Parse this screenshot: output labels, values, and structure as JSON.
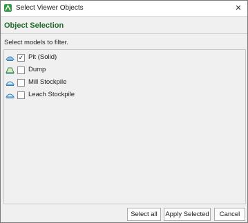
{
  "window": {
    "title": "Select Viewer Objects"
  },
  "section": {
    "heading": "Object Selection",
    "instruction": "Select models to filter."
  },
  "models": [
    {
      "label": "Pit (Solid)",
      "checked": true,
      "icon": "pit-model-icon"
    },
    {
      "label": "Dump",
      "checked": false,
      "icon": "dump-model-icon"
    },
    {
      "label": "Mill Stockpile",
      "checked": false,
      "icon": "stockpile-model-icon"
    },
    {
      "label": "Leach Stockpile",
      "checked": false,
      "icon": "stockpile-model-icon"
    }
  ],
  "buttons": {
    "select_all": "Select all",
    "apply_selected": "Apply Selected",
    "cancel": "Cancel"
  },
  "colors": {
    "heading": "#1f6b2a",
    "app_icon": "#2e9e3e",
    "model_icon": "#2f7fb8"
  }
}
